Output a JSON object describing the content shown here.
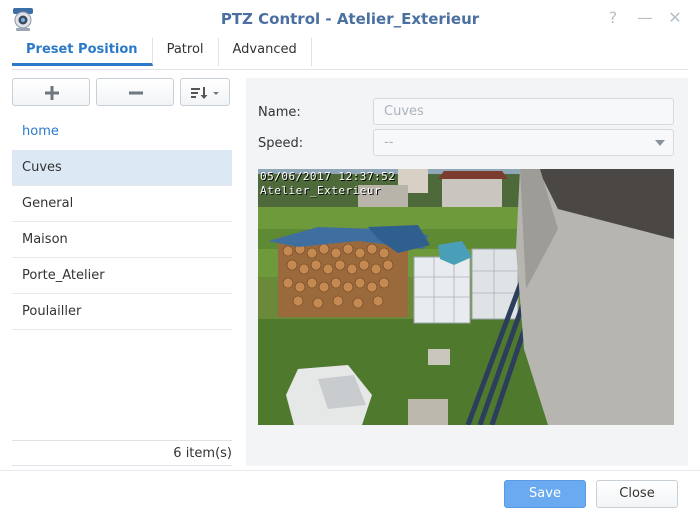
{
  "window": {
    "title": "PTZ Control - Atelier_Exterieur",
    "help_label": "?",
    "minimize_label": "—",
    "close_label": "✕"
  },
  "tabs": [
    {
      "label": "Preset Position",
      "active": true
    },
    {
      "label": "Patrol",
      "active": false
    },
    {
      "label": "Advanced",
      "active": false
    }
  ],
  "toolbar": {
    "add_icon": "plus-icon",
    "remove_icon": "minus-icon",
    "sort_icon": "sort-icon"
  },
  "presets": {
    "items": [
      "home",
      "Cuves",
      "General",
      "Maison",
      "Porte_Atelier",
      "Poulailler"
    ],
    "selected": "Cuves",
    "count_label": "6 item(s)"
  },
  "form": {
    "name_label": "Name:",
    "name_placeholder": "Cuves",
    "speed_label": "Speed:",
    "speed_value": "--"
  },
  "camera": {
    "timestamp": "05/06/2017 12:37:52",
    "camera_name": "Atelier_Exterieur"
  },
  "footer": {
    "save_label": "Save",
    "close_label": "Close"
  },
  "colors": {
    "accent": "#2b7ac9",
    "title": "#4a6fa0",
    "save_button": "#6aaaf0",
    "selected_row": "#dce9f5"
  }
}
